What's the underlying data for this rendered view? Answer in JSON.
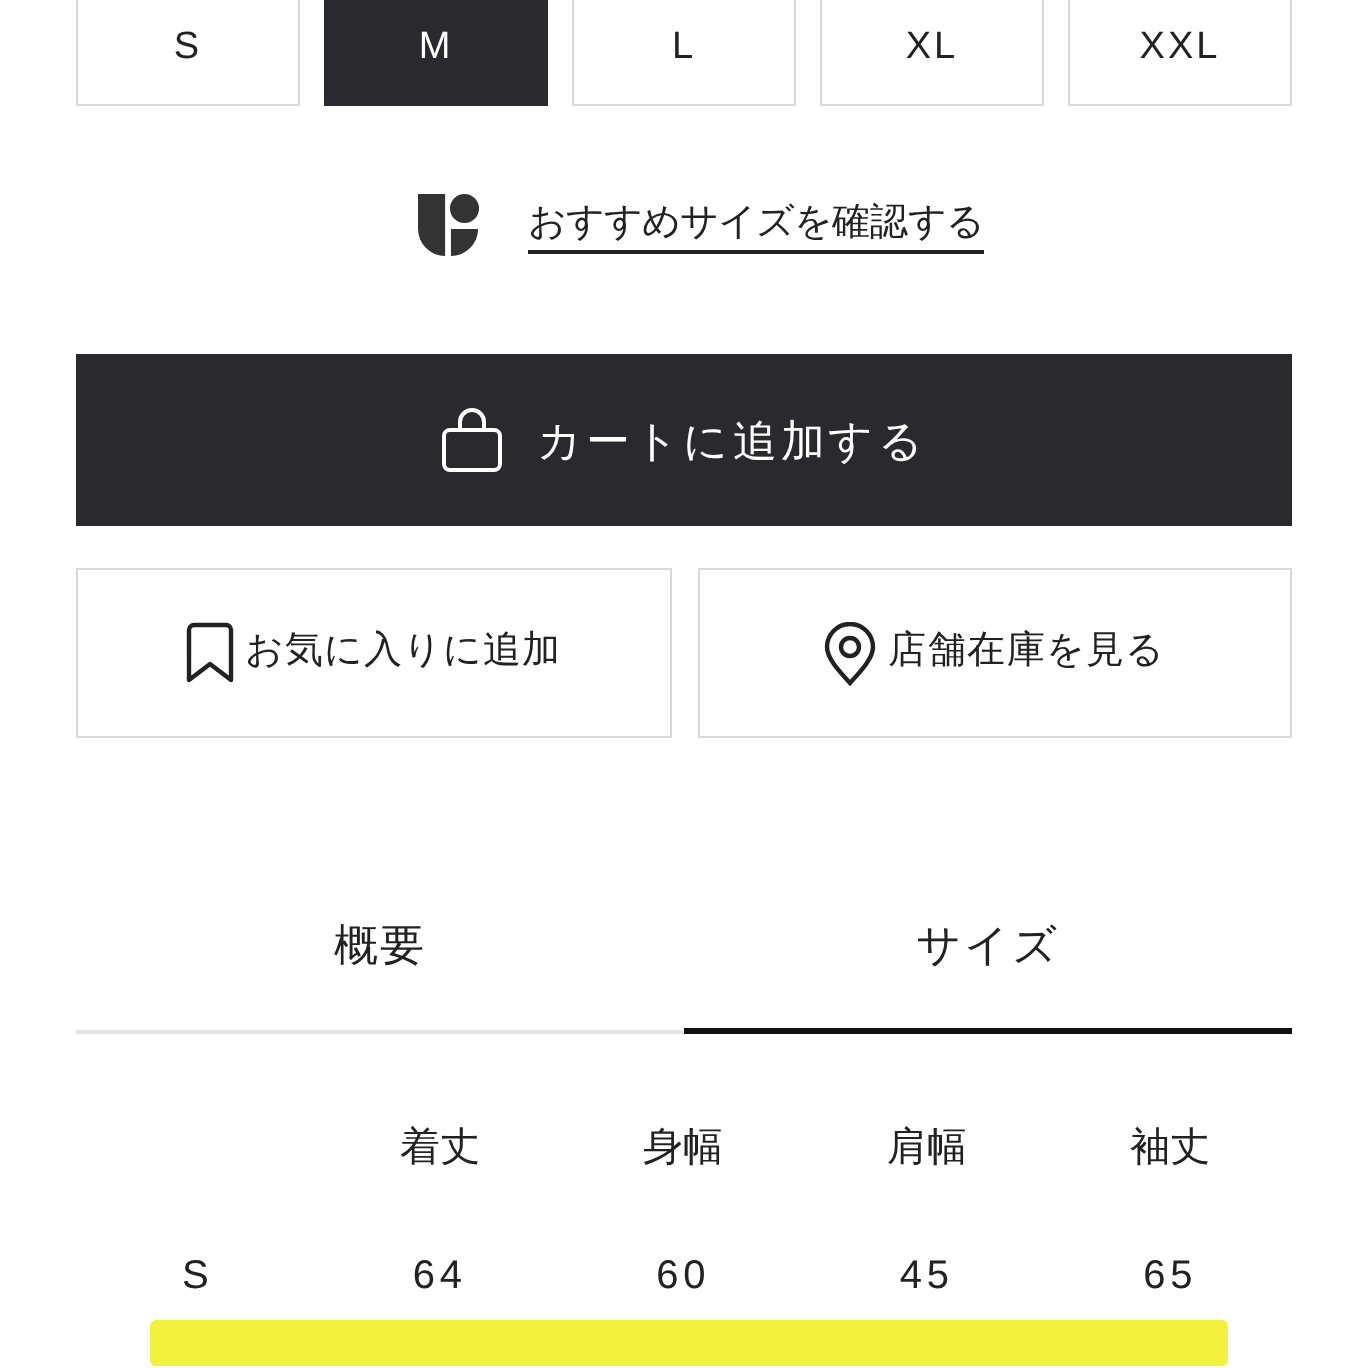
{
  "size_options": [
    {
      "label": "S",
      "selected": false
    },
    {
      "label": "M",
      "selected": true
    },
    {
      "label": "L",
      "selected": false
    },
    {
      "label": "XL",
      "selected": false
    },
    {
      "label": "XXL",
      "selected": false
    }
  ],
  "recommend_link": {
    "text": "おすすめサイズを確認する"
  },
  "add_to_cart_button": {
    "label": "カートに追加する"
  },
  "secondary_buttons": [
    {
      "kind": "bookmark",
      "label": "お気に入りに追加"
    },
    {
      "kind": "pin",
      "label": "店舗在庫を見る"
    }
  ],
  "tabs": [
    {
      "label": "概要",
      "selected": false
    },
    {
      "label": "サイズ",
      "selected": true
    }
  ],
  "size_table": {
    "columns": [
      "着丈",
      "身幅",
      "肩幅",
      "袖丈"
    ],
    "rows": [
      {
        "size": "S",
        "values": [
          "64",
          "60",
          "45",
          "65"
        ],
        "highlighted": false
      },
      {
        "highlighted": true
      }
    ]
  }
}
